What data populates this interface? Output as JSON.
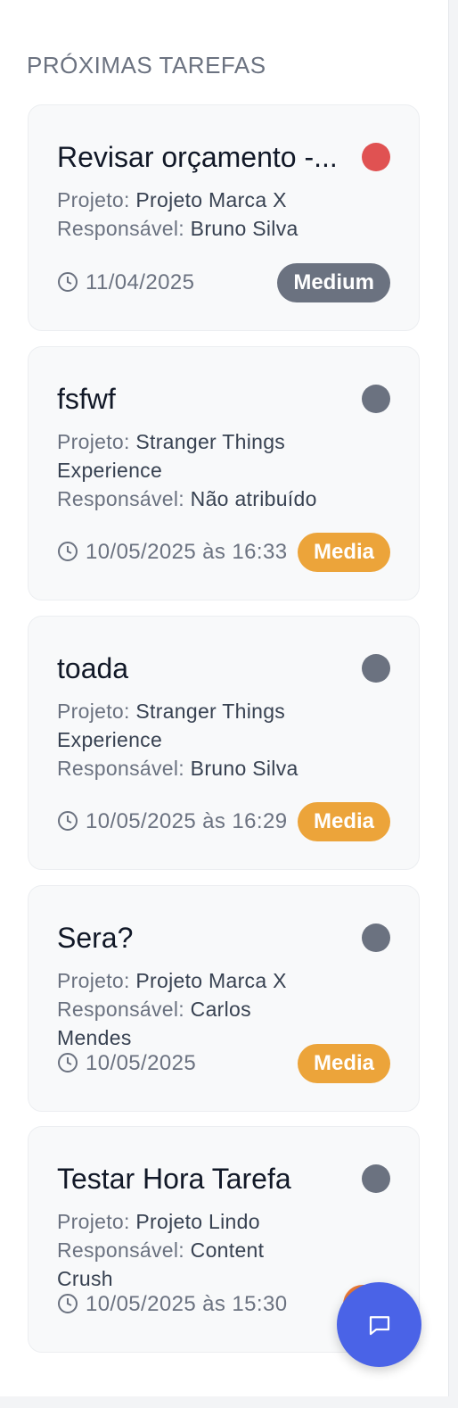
{
  "section_title": "PRÓXIMAS TAREFAS",
  "labels": {
    "project": "Projeto:",
    "assignee": "Responsável:"
  },
  "tasks": [
    {
      "title": "Revisar orçamento -...",
      "project": "Projeto Marca X",
      "assignee": "Bruno Silva",
      "date": "11/04/2025",
      "priority": "Medium",
      "priority_color": "#6b7280",
      "status_color": "#e05252"
    },
    {
      "title": "fsfwf",
      "project": "Stranger Things Experience",
      "assignee": "Não atribuído",
      "date": "10/05/2025 às 16:33",
      "priority": "Media",
      "priority_color": "#eca43a",
      "status_color": "#6b7280"
    },
    {
      "title": "toada",
      "project": "Stranger Things Experience",
      "assignee": "Bruno Silva",
      "date": "10/05/2025 às 16:29",
      "priority": "Media",
      "priority_color": "#eca43a",
      "status_color": "#6b7280"
    },
    {
      "title": "Sera?",
      "project": "Projeto Marca X",
      "assignee": "Carlos Mendes",
      "date": "10/05/2025",
      "priority": "Media",
      "priority_color": "#eca43a",
      "status_color": "#6b7280"
    },
    {
      "title": "Testar Hora Tarefa",
      "project": "Projeto Lindo",
      "assignee": "Content Crush",
      "date": "10/05/2025 às 15:30",
      "priority": "A",
      "priority_color": "#ec7a35",
      "status_color": "#6b7280"
    }
  ],
  "icons": {
    "date": "clock-icon",
    "chat": "chat-bubble-icon"
  },
  "colors": {
    "fab": "#4a63e7"
  }
}
